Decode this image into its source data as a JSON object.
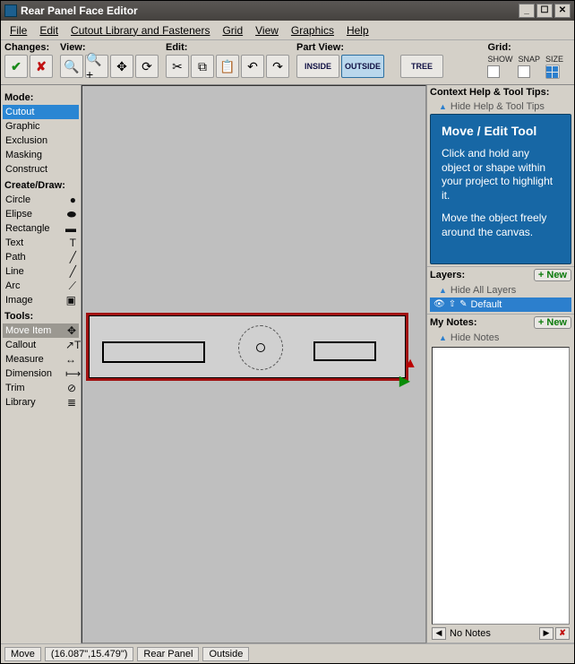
{
  "title": "Rear Panel Face Editor",
  "menu": [
    "File",
    "Edit",
    "Cutout Library and Fasteners",
    "Grid",
    "View",
    "Graphics",
    "Help"
  ],
  "toolbar": {
    "changes_label": "Changes:",
    "view_label": "View:",
    "edit_label": "Edit:",
    "partview_label": "Part View:",
    "grid_label": "Grid:",
    "grid_cols": [
      "SHOW",
      "SNAP",
      "SIZE"
    ],
    "inside": "INSIDE",
    "outside": "OUTSIDE",
    "tree": "TREE"
  },
  "left": {
    "mode_label": "Mode:",
    "modes": [
      "Cutout",
      "Graphic",
      "Exclusion",
      "Masking",
      "Construct"
    ],
    "create_label": "Create/Draw:",
    "draw": [
      {
        "label": "Circle",
        "g": "●"
      },
      {
        "label": "Elipse",
        "g": "⬬"
      },
      {
        "label": "Rectangle",
        "g": "▬"
      },
      {
        "label": "Text",
        "g": "T"
      },
      {
        "label": "Path",
        "g": "╱"
      },
      {
        "label": "Line",
        "g": "╱"
      },
      {
        "label": "Arc",
        "g": "⟋"
      },
      {
        "label": "Image",
        "g": "▣"
      }
    ],
    "tools_label": "Tools:",
    "tools": [
      {
        "label": "Move Item",
        "g": "✥"
      },
      {
        "label": "Callout",
        "g": "↗T"
      },
      {
        "label": "Measure",
        "g": "↔"
      },
      {
        "label": "Dimension",
        "g": "⟼"
      },
      {
        "label": "Trim",
        "g": "⊘"
      },
      {
        "label": "Library",
        "g": "≣"
      }
    ]
  },
  "right": {
    "context_label": "Context Help & Tool Tips:",
    "hide_help": "Hide Help & Tool Tips",
    "help_title": "Move / Edit Tool",
    "help_p1": "Click and hold any object or shape within your project to highlight it.",
    "help_p2": "Move the object freely around the canvas.",
    "layers_label": "Layers:",
    "hide_layers": "Hide All Layers",
    "new_label": "+ New",
    "layer_name": "Default",
    "notes_label": "My Notes:",
    "hide_notes": "Hide Notes",
    "no_notes": "No Notes"
  },
  "status": {
    "tool": "Move",
    "coords": "(16.087\",15.479\")",
    "part": "Rear Panel",
    "side": "Outside"
  }
}
